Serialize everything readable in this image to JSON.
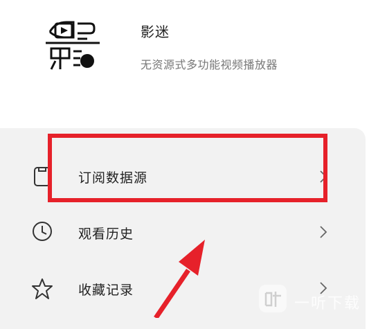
{
  "app": {
    "name": "影迷",
    "description": "无资源式多功能视频播放器"
  },
  "menu": {
    "items": [
      {
        "label": "订阅数据源",
        "icon": "subscription-icon"
      },
      {
        "label": "观看历史",
        "icon": "clock-icon"
      },
      {
        "label": "收藏记录",
        "icon": "star-icon"
      }
    ]
  },
  "watermark": {
    "text": "一听下载"
  },
  "colors": {
    "highlight": "#e6212a",
    "card_bg": "#f2f2f2",
    "desc_text": "#777777"
  }
}
